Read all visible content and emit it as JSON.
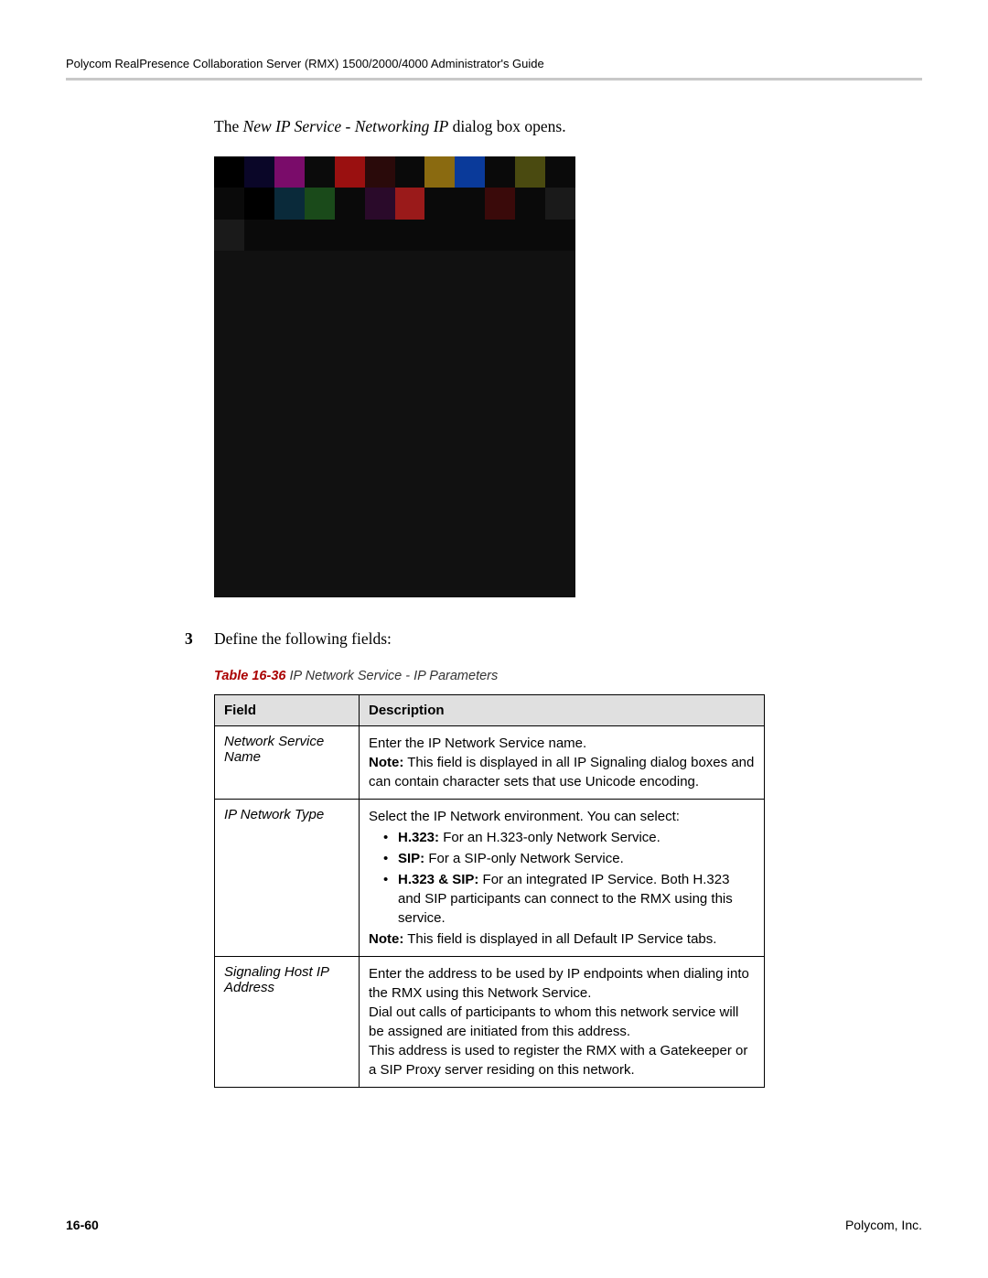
{
  "header": {
    "title": "Polycom RealPresence Collaboration Server (RMX) 1500/2000/4000 Administrator's Guide"
  },
  "intro": {
    "prefix": "The ",
    "italic": "New IP Service - Networking IP",
    "suffix": " dialog box opens."
  },
  "step": {
    "number": "3",
    "text": "Define the following fields:"
  },
  "table_caption": {
    "label": "Table 16-36",
    "title": " IP Network Service - IP Parameters"
  },
  "table": {
    "headers": {
      "field": "Field",
      "description": "Description"
    },
    "rows": [
      {
        "field": "Network Service Name",
        "desc": {
          "line1": "Enter the IP Network Service name.",
          "note_label": "Note:",
          "note_text": " This field is displayed in all IP Signaling dialog boxes and can contain character sets that use Unicode encoding."
        }
      },
      {
        "field": "IP Network Type",
        "desc": {
          "line1": "Select the IP Network environment. You can select:",
          "bullets": [
            {
              "bold": "H.323:",
              "text": " For an H.323-only Network Service."
            },
            {
              "bold": "SIP:",
              "text": " For a SIP-only Network Service."
            },
            {
              "bold": "H.323 & SIP:",
              "text": " For an integrated IP Service. Both H.323 and SIP participants can connect to the RMX using this service."
            }
          ],
          "note_label": "Note:",
          "note_text": " This field is displayed in all Default IP Service tabs."
        }
      },
      {
        "field": "Signaling Host IP Address",
        "desc": {
          "line1": "Enter the address to be used by IP endpoints when dialing into the RMX using this Network Service.",
          "line2": "Dial out calls of participants to whom this network service will be assigned are initiated from this address.",
          "line3": "This address is used to register the RMX with a Gatekeeper or a SIP Proxy server residing on this network."
        }
      }
    ]
  },
  "footer": {
    "page": "16-60",
    "company": "Polycom, Inc."
  }
}
